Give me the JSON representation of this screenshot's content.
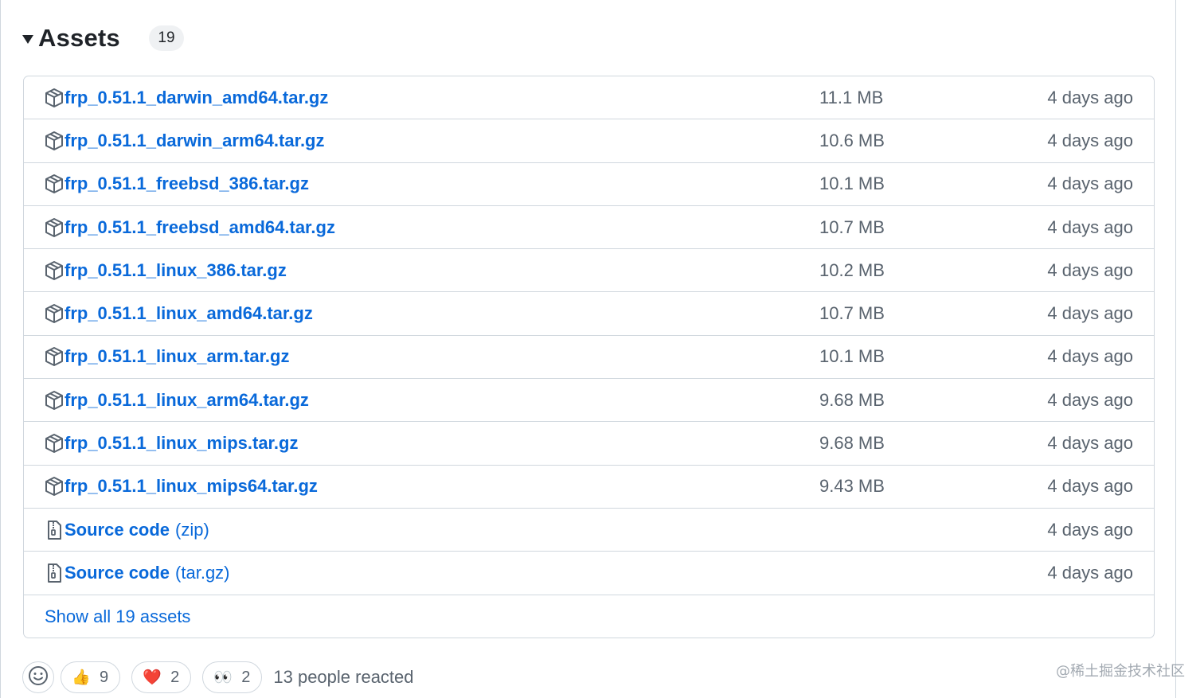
{
  "assets": {
    "title": "Assets",
    "count": "19",
    "items": [
      {
        "name": "frp_0.51.1_darwin_amd64.tar.gz",
        "size": "11.1 MB",
        "date": "4 days ago",
        "icon": "package-icon"
      },
      {
        "name": "frp_0.51.1_darwin_arm64.tar.gz",
        "size": "10.6 MB",
        "date": "4 days ago",
        "icon": "package-icon"
      },
      {
        "name": "frp_0.51.1_freebsd_386.tar.gz",
        "size": "10.1 MB",
        "date": "4 days ago",
        "icon": "package-icon"
      },
      {
        "name": "frp_0.51.1_freebsd_amd64.tar.gz",
        "size": "10.7 MB",
        "date": "4 days ago",
        "icon": "package-icon"
      },
      {
        "name": "frp_0.51.1_linux_386.tar.gz",
        "size": "10.2 MB",
        "date": "4 days ago",
        "icon": "package-icon"
      },
      {
        "name": "frp_0.51.1_linux_amd64.tar.gz",
        "size": "10.7 MB",
        "date": "4 days ago",
        "icon": "package-icon"
      },
      {
        "name": "frp_0.51.1_linux_arm.tar.gz",
        "size": "10.1 MB",
        "date": "4 days ago",
        "icon": "package-icon"
      },
      {
        "name": "frp_0.51.1_linux_arm64.tar.gz",
        "size": "9.68 MB",
        "date": "4 days ago",
        "icon": "package-icon"
      },
      {
        "name": "frp_0.51.1_linux_mips.tar.gz",
        "size": "9.68 MB",
        "date": "4 days ago",
        "icon": "package-icon"
      },
      {
        "name": "frp_0.51.1_linux_mips64.tar.gz",
        "size": "9.43 MB",
        "date": "4 days ago",
        "icon": "package-icon"
      }
    ],
    "source": [
      {
        "name": "Source code",
        "suffix": "(zip)",
        "date": "4 days ago",
        "icon": "file-zip-icon"
      },
      {
        "name": "Source code",
        "suffix": "(tar.gz)",
        "date": "4 days ago",
        "icon": "file-zip-icon"
      }
    ],
    "show_all": "Show all 19 assets"
  },
  "reactions": {
    "add_icon": "smiley-icon",
    "items": [
      {
        "emoji": "👍",
        "count": "9",
        "icon": "thumbs-up-icon"
      },
      {
        "emoji": "❤️",
        "count": "2",
        "icon": "heart-icon"
      },
      {
        "emoji": "👀",
        "count": "2",
        "icon": "eyes-icon"
      }
    ],
    "summary": "13 people reacted"
  },
  "watermark": "@稀土掘金技术社区",
  "colors": {
    "link": "#0969da",
    "muted": "#59636e",
    "border": "#d0d7de",
    "badge_bg": "#eff1f3"
  }
}
